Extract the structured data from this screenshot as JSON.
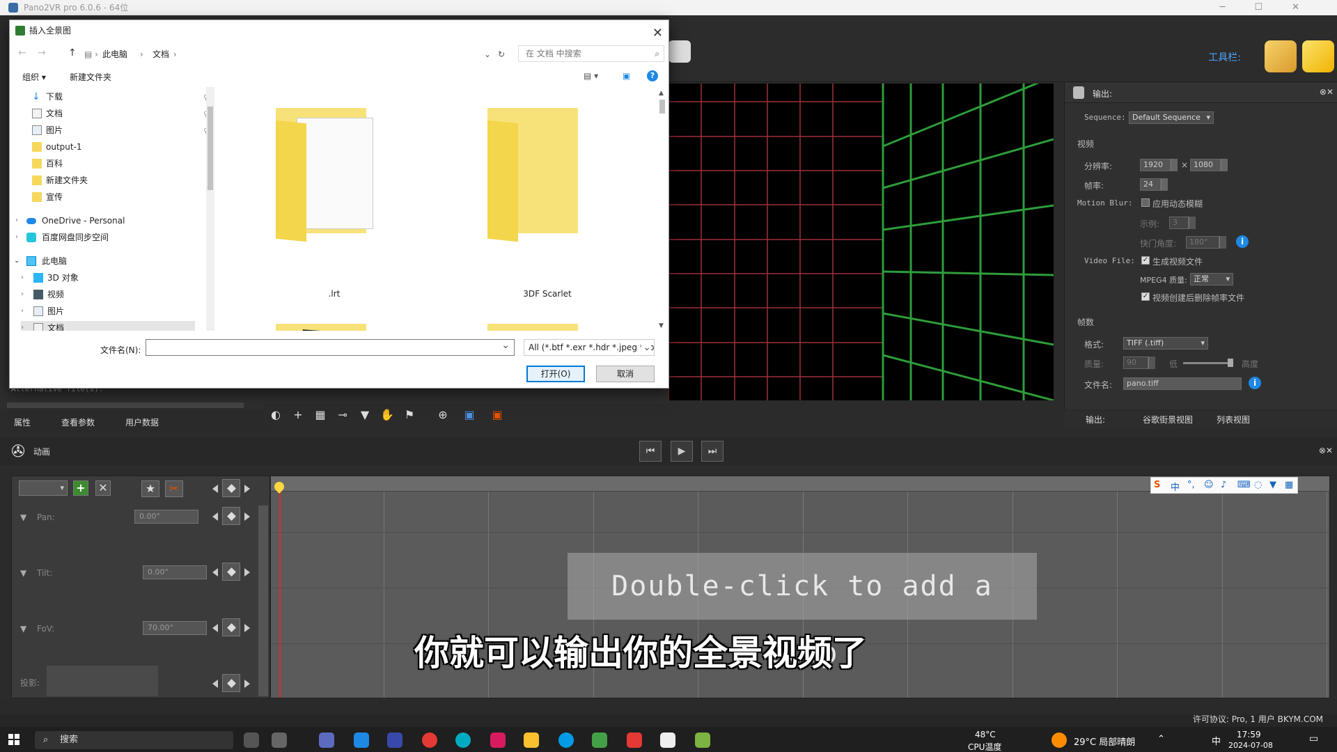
{
  "titlebar": {
    "title": "Pano2VR pro 6.0.6 - 64位"
  },
  "toolbar": {
    "label": "工具栏:"
  },
  "right_panel": {
    "header": "输出:",
    "sequence_label": "Sequence:",
    "sequence_value": "Default Sequence",
    "video_section": "视频",
    "resolution_label": "分辨率:",
    "res_width": "1920",
    "res_x": "×",
    "res_height": "1080",
    "fps_label": "帧率:",
    "fps_value": "24",
    "motion_blur_label": "Motion Blur:",
    "motion_blur_check": "应用动态模糊",
    "samples_label": "示例:",
    "samples_value": "3",
    "shutter_label": "快门角度:",
    "shutter_value": "180°",
    "video_file_label": "Video File:",
    "video_file_check": "生成视频文件",
    "mpeg4_label": "MPEG4 质量:",
    "mpeg4_value": "正常",
    "delete_frames_check": "视频创建后删除帧率文件",
    "frames_section": "帧数",
    "format_label": "格式:",
    "format_value": "TIFF (.tiff)",
    "quality_label": "质量:",
    "quality_value": "90",
    "quality_low": "低",
    "quality_high": "高度",
    "filename_label": "文件名:",
    "filename_value": "pano.tiff",
    "tabs": [
      "输出:",
      "谷歌街景视图",
      "列表视图"
    ]
  },
  "left_tabs": [
    "属性",
    "查看参数",
    "用户数据"
  ],
  "left_panel_label": "Alternative file(s):",
  "animation": {
    "title": "动画",
    "tracks": [
      {
        "name": "Pan:",
        "value": "0.00°"
      },
      {
        "name": "Tilt:",
        "value": "0.00°"
      },
      {
        "name": "FoV:",
        "value": "70.00°"
      },
      {
        "name": "投影:",
        "value": ""
      }
    ],
    "clip_hint": "Double-click to add a clip"
  },
  "license": "许可协议: Pro, 1 用户 BKYM.COM",
  "subtitle": "你就可以输出你的全景视频了",
  "dialog": {
    "title": "插入全景图",
    "breadcrumb": [
      "此电脑",
      "文档"
    ],
    "search_placeholder": "在 文档 中搜索",
    "organize": "组织 ▾",
    "new_folder": "新建文件夹",
    "nav_items": [
      {
        "label": "下载",
        "type": "download",
        "pinned": true
      },
      {
        "label": "文档",
        "type": "doc",
        "pinned": true
      },
      {
        "label": "图片",
        "type": "pic",
        "pinned": true
      },
      {
        "label": "output-1",
        "type": "folder",
        "pinned": false
      },
      {
        "label": "百科",
        "type": "folder",
        "pinned": false
      },
      {
        "label": "新建文件夹",
        "type": "folder",
        "pinned": false
      },
      {
        "label": "宣传",
        "type": "folder",
        "pinned": false
      }
    ],
    "onedrive": "OneDrive - Personal",
    "baidu": "百度网盘同步空间",
    "this_pc": "此电脑",
    "pc_items": [
      "3D 对象",
      "视频",
      "图片",
      "文档"
    ],
    "folders": [
      ".lrt",
      "3DF Scarlet"
    ],
    "filename_label": "文件名(N):",
    "filename_value": "",
    "filetype": "All (*.btf *.exr *.hdr *.jpeg *.jpg",
    "open": "打开(O)",
    "cancel": "取消"
  },
  "taskbar": {
    "search": "搜索",
    "cpu_temp": "48°C",
    "cpu_label": "CPU温度",
    "weather": "29°C 局部晴朗",
    "ime": "中",
    "time": "17:59",
    "date": "2024-07-08"
  }
}
